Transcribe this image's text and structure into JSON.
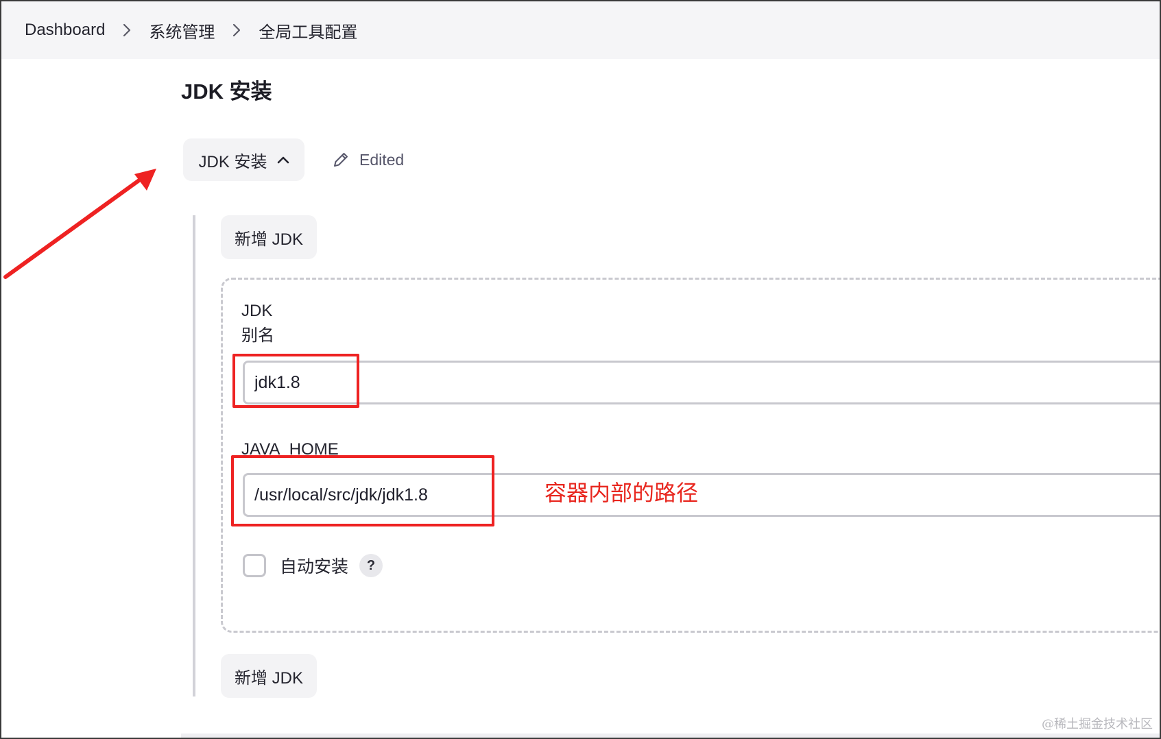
{
  "breadcrumb": {
    "items": [
      "Dashboard",
      "系统管理",
      "全局工具配置"
    ]
  },
  "section": {
    "title": "JDK 安装",
    "toggle_label": "JDK 安装",
    "edited_label": "Edited"
  },
  "add_buttons": {
    "top_label": "新增 JDK",
    "bottom_label": "新增 JDK"
  },
  "jdk_item": {
    "label_jdk": "JDK",
    "label_alias": "别名",
    "alias_value": "jdk1.8",
    "label_java_home": "JAVA_HOME",
    "java_home_value": "/usr/local/src/jdk/jdk1.8",
    "auto_install_label": "自动安装",
    "auto_install_checked": false,
    "help_label": "?"
  },
  "annotations": {
    "note": "容器内部的路径",
    "color": "#e8271f"
  },
  "icons": {
    "breadcrumb_separator": "chevron-right-icon",
    "toggle": "chevron-up-icon",
    "edited": "pencil-icon"
  },
  "watermark": "@稀土掘金技术社区"
}
